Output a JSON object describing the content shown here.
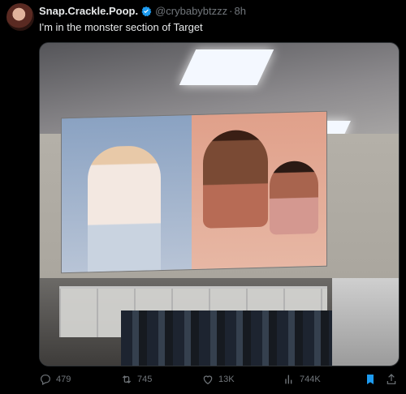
{
  "tweet": {
    "display_name": "Snap.Crackle.Poop.",
    "handle": "@crybabybtzzz",
    "separator": "·",
    "time": "8h",
    "text": "I'm in the monster section of Target",
    "verified": true
  },
  "actions": {
    "replies": "479",
    "retweets": "745",
    "likes": "13K",
    "views": "744K"
  },
  "icons": {
    "reply": "reply-icon",
    "retweet": "retweet-icon",
    "like": "heart-icon",
    "views": "views-icon",
    "bookmark": "bookmark-icon",
    "share": "share-icon"
  },
  "colors": {
    "accent": "#1d9bf0",
    "muted": "#71767b",
    "text": "#e7e9ea",
    "background": "#000000"
  }
}
